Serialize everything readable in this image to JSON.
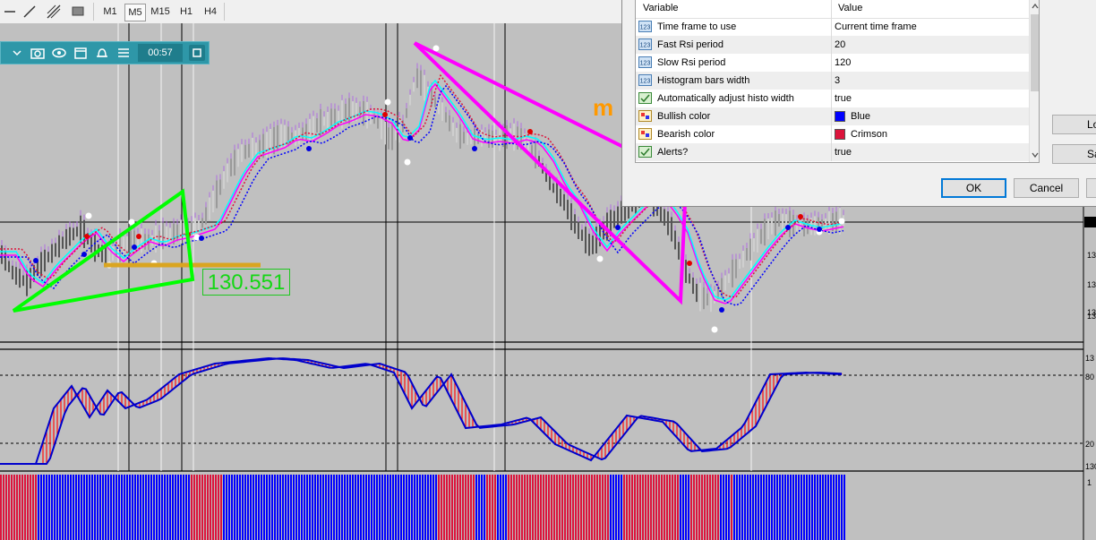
{
  "toolbar": {
    "timeframes": [
      "M1",
      "M5",
      "M15",
      "H1",
      "H4"
    ],
    "selected": "M5"
  },
  "quick_panel": {
    "time": "00:57"
  },
  "chart": {
    "price_label": "130.551",
    "overlay_text": "m",
    "price_axis": [
      "13",
      "13",
      "13",
      "13",
      "13"
    ],
    "rsi_axis": [
      "13",
      "80",
      "20",
      "130"
    ],
    "histo_axis": [
      "1"
    ]
  },
  "dialog": {
    "header": {
      "variable": "Variable",
      "value": "Value"
    },
    "rows": [
      {
        "variable": "Time frame to use",
        "value": "Current time frame",
        "icon": "number-123-icon"
      },
      {
        "variable": "Fast Rsi period",
        "value": "20",
        "icon": "number-123-icon"
      },
      {
        "variable": "Slow Rsi period",
        "value": "120",
        "icon": "number-123-icon"
      },
      {
        "variable": "Histogram bars width",
        "value": "3",
        "icon": "number-123-icon"
      },
      {
        "variable": "Automatically adjust histo width",
        "value": "true",
        "icon": "boolean-icon"
      },
      {
        "variable": "Bullish color",
        "value": "Blue",
        "icon": "color-palette-icon",
        "swatch": "#0000ff"
      },
      {
        "variable": "Bearish color",
        "value": "Crimson",
        "icon": "color-palette-icon",
        "swatch": "#dc143c"
      },
      {
        "variable": "Alerts?",
        "value": "true",
        "icon": "boolean-icon"
      }
    ],
    "side_buttons": [
      "Lo",
      "Sa"
    ],
    "ok_label": "OK",
    "cancel_label": "Cancel"
  },
  "colors": {
    "chart_bg": "#c0c0c0",
    "bullish": "#0000ff",
    "bearish": "#dc143c",
    "fast_line": "#00ffff",
    "slow_line": "#ff00ff",
    "drawing_green": "#00ff00",
    "drawing_magenta": "#ff00ff",
    "level_orange": "#daa520"
  }
}
